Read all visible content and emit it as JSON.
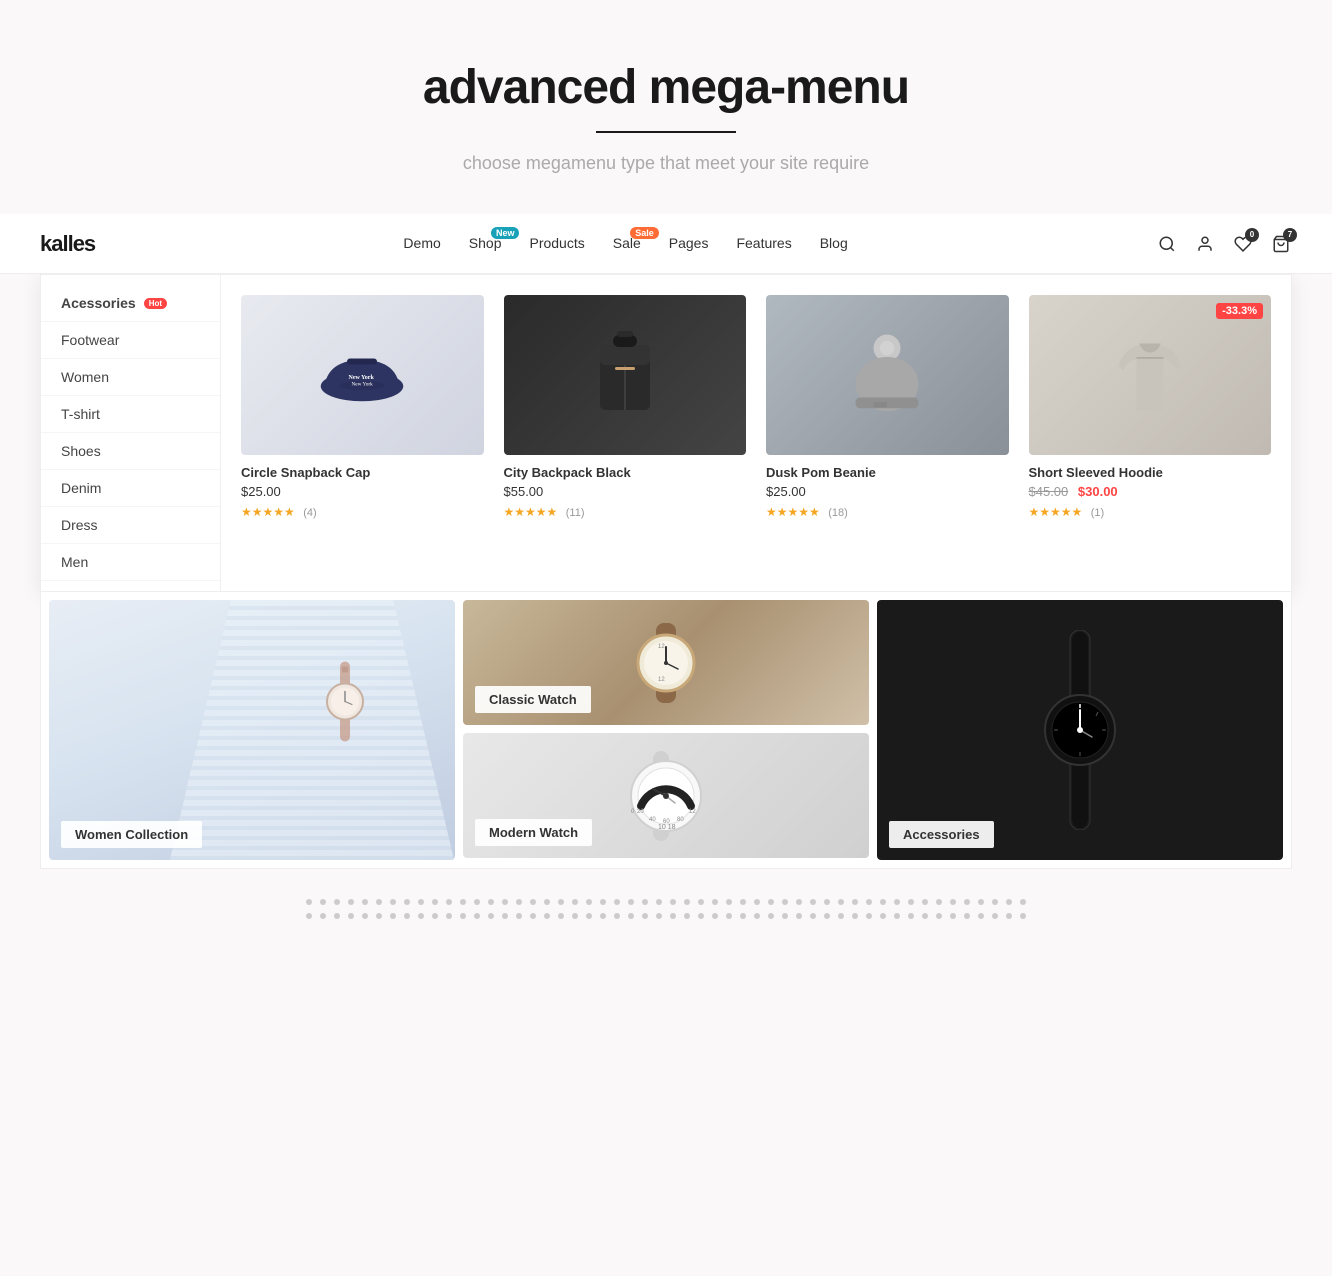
{
  "hero": {
    "title": "advanced mega-menu",
    "subtitle": "choose megamenu type that meet your site require"
  },
  "navbar": {
    "logo": "kalles",
    "links": [
      {
        "label": "Demo",
        "badge": null
      },
      {
        "label": "Shop",
        "badge": "New",
        "badge_type": "new"
      },
      {
        "label": "Products",
        "badge": null
      },
      {
        "label": "Sale",
        "badge": "Sale",
        "badge_type": "sale"
      },
      {
        "label": "Pages",
        "badge": null
      },
      {
        "label": "Features",
        "badge": null
      },
      {
        "label": "Blog",
        "badge": null
      }
    ],
    "icons": {
      "wishlist_count": "0",
      "cart_count": "7"
    }
  },
  "megamenu": {
    "sidebar": [
      {
        "label": "Acessories",
        "badge": "Hot",
        "active": true
      },
      {
        "label": "Footwear"
      },
      {
        "label": "Women"
      },
      {
        "label": "T-shirt"
      },
      {
        "label": "Shoes"
      },
      {
        "label": "Denim"
      },
      {
        "label": "Dress"
      },
      {
        "label": "Men"
      }
    ],
    "products": [
      {
        "name": "Circle Snapback Cap",
        "price": "$25.00",
        "old_price": null,
        "new_price": null,
        "stars": 5,
        "rating_count": "4",
        "discount": null,
        "img_class": "img-cap",
        "img_icon": "🧢"
      },
      {
        "name": "City Backpack Black",
        "price": "$55.00",
        "old_price": null,
        "new_price": null,
        "stars": 5,
        "rating_count": "11",
        "discount": null,
        "img_class": "img-bag",
        "img_icon": "🎒"
      },
      {
        "name": "Dusk Pom Beanie",
        "price": "$25.00",
        "old_price": null,
        "new_price": null,
        "stars": 5,
        "rating_count": "18",
        "discount": null,
        "img_class": "img-beanie",
        "img_icon": "🧣"
      },
      {
        "name": "Short Sleeved Hoodie",
        "price": null,
        "old_price": "$45.00",
        "new_price": "$30.00",
        "stars": 5,
        "rating_count": "1",
        "discount": "-33.3%",
        "img_class": "img-hoodie",
        "img_icon": "👕"
      }
    ]
  },
  "collections": [
    {
      "label": "Women Collection",
      "bg": "women",
      "size": "large"
    },
    {
      "label": "Classic Watch",
      "bg": "classic",
      "size": "small"
    },
    {
      "label": "Modern Watch",
      "bg": "modern",
      "size": "small"
    },
    {
      "label": "Accessories",
      "bg": "accessories",
      "size": "large"
    }
  ],
  "dots": {
    "rows": 2,
    "cols": 52
  }
}
